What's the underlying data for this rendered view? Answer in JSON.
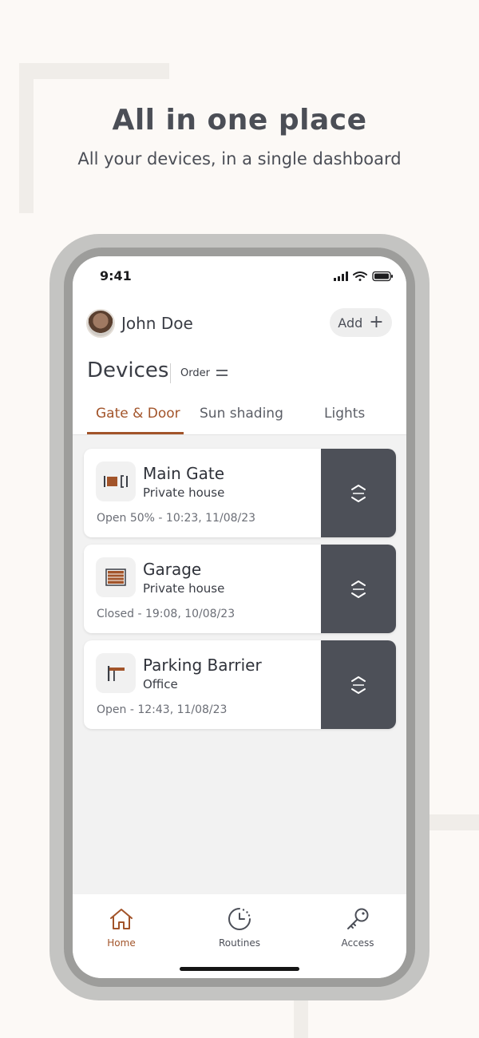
{
  "promo": {
    "headline": "All in one place",
    "subline": "All your devices, in a single dashboard"
  },
  "status_bar": {
    "time": "9:41",
    "icons": [
      "signal-icon",
      "wifi-icon",
      "battery-icon"
    ]
  },
  "header": {
    "user_name": "John Doe",
    "add_label": "Add",
    "section_title": "Devices",
    "order_label": "Order"
  },
  "tabs": [
    {
      "label": "Gate & Door",
      "active": true
    },
    {
      "label": "Sun shading",
      "active": false
    },
    {
      "label": "Lights",
      "active": false
    }
  ],
  "devices": [
    {
      "name": "Main Gate",
      "location": "Private house",
      "status": "Open 50% - 10:23, 11/08/23",
      "icon": "gate-icon"
    },
    {
      "name": "Garage",
      "location": "Private house",
      "status": "Closed - 19:08, 10/08/23",
      "icon": "garage-door-icon"
    },
    {
      "name": "Parking Barrier",
      "location": "Office",
      "status": "Open - 12:43, 11/08/23",
      "icon": "parking-barrier-icon"
    }
  ],
  "bottom_nav": [
    {
      "label": "Home",
      "icon": "home-icon",
      "active": true
    },
    {
      "label": "Routines",
      "icon": "clock-icon",
      "active": false
    },
    {
      "label": "Access",
      "icon": "key-icon",
      "active": false
    }
  ],
  "colors": {
    "accent": "#a2542a",
    "background": "#fcf9f6",
    "action_button": "#4d5058",
    "text_dark": "#3a3d45"
  }
}
